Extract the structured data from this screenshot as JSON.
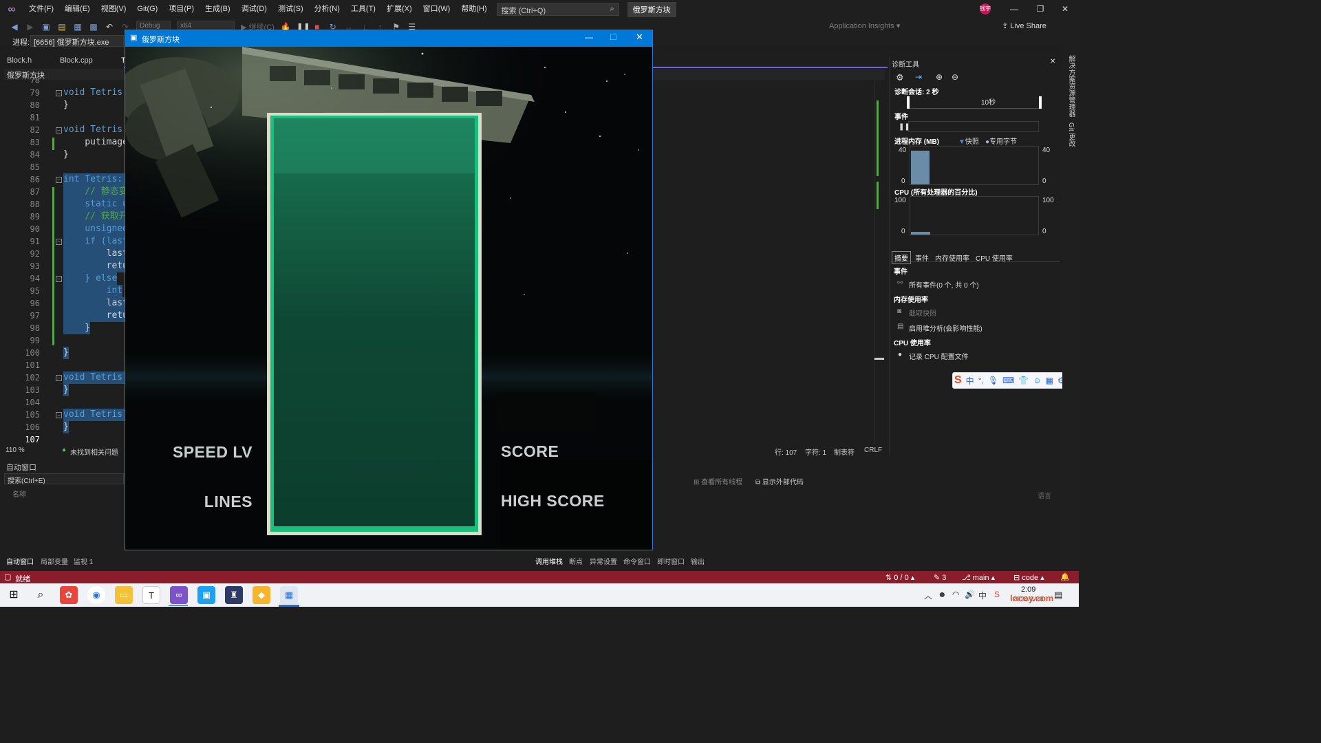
{
  "menubar": {
    "items": [
      "文件(F)",
      "编辑(E)",
      "视图(V)",
      "Git(G)",
      "项目(P)",
      "生成(B)",
      "调试(D)",
      "测试(S)",
      "分析(N)",
      "工具(T)",
      "扩展(X)",
      "窗口(W)",
      "帮助(H)"
    ],
    "search_placeholder": "搜索 (Ctrl+Q)",
    "solution_name": "俄罗斯方块",
    "user_initials": "钱宇"
  },
  "toolbar": {
    "config": "Debug",
    "platform": "x64",
    "continue_label": "继续(C)",
    "app_insights": "Application Insights",
    "live_share": "Live Share"
  },
  "process": {
    "label": "进程:",
    "value": "[6656] 俄罗斯方块.exe"
  },
  "tabs": {
    "items": [
      "Block.h",
      "Block.cpp",
      "T"
    ],
    "scope": "俄罗斯方块"
  },
  "editor": {
    "lines": [
      {
        "num": "78",
        "text": ""
      },
      {
        "num": "79",
        "text": "void Tetris::"
      },
      {
        "num": "80",
        "text": "}"
      },
      {
        "num": "81",
        "text": ""
      },
      {
        "num": "82",
        "text": "void Tetris::"
      },
      {
        "num": "83",
        "text": "    putimage"
      },
      {
        "num": "84",
        "text": "}"
      },
      {
        "num": "85",
        "text": ""
      },
      {
        "num": "86",
        "text": "int Tetris::g"
      },
      {
        "num": "87",
        "text": "    // 静态变"
      },
      {
        "num": "88",
        "text": "    static u"
      },
      {
        "num": "89",
        "text": "    // 获取开"
      },
      {
        "num": "90",
        "text": "    unsigned"
      },
      {
        "num": "91",
        "text": "    if (last"
      },
      {
        "num": "92",
        "text": "        last"
      },
      {
        "num": "93",
        "text": "        retu"
      },
      {
        "num": "94",
        "text": "    } else"
      },
      {
        "num": "95",
        "text": "        int"
      },
      {
        "num": "96",
        "text": "        last"
      },
      {
        "num": "97",
        "text": "        retu"
      },
      {
        "num": "98",
        "text": "    }"
      },
      {
        "num": "99",
        "text": ""
      },
      {
        "num": "100",
        "text": "}"
      },
      {
        "num": "101",
        "text": ""
      },
      {
        "num": "102",
        "text": "void Tetris::"
      },
      {
        "num": "103",
        "text": "}"
      },
      {
        "num": "104",
        "text": ""
      },
      {
        "num": "105",
        "text": "void Tetris::"
      },
      {
        "num": "106",
        "text": "}"
      },
      {
        "num": "107",
        "text": ""
      }
    ],
    "zoom": "110 %",
    "issues": "未找到相关问题",
    "line_label": "行: 107",
    "char_label": "字符: 1",
    "indent_label": "制表符",
    "eol_label": "CRLF"
  },
  "autos": {
    "title": "自动窗口",
    "search_placeholder": "搜索(Ctrl+E)",
    "col_name": "名称",
    "col_lang": "语言",
    "bottom_tabs": [
      "自动窗口",
      "局部变量",
      "监视 1"
    ]
  },
  "callstack": {
    "show_threads": "查看所有线程",
    "show_external": "显示外部代码",
    "bottom_tabs": [
      "调用堆栈",
      "断点",
      "异常设置",
      "命令窗口",
      "即时窗口",
      "输出"
    ]
  },
  "diagnostics": {
    "title": "诊断工具",
    "session": "诊断会话: 2 秒",
    "timeline_label": "10秒",
    "events_header": "事件",
    "memory_header": "进程内存 (MB)",
    "memory_legend_snapshot": "快照",
    "memory_legend_private": "专用字节",
    "memory_max_left": "40",
    "memory_min_left": "0",
    "memory_max_right": "40",
    "memory_min_right": "0",
    "cpu_header": "CPU (所有处理器的百分比)",
    "cpu_max_left": "100",
    "cpu_min_left": "0",
    "cpu_max_right": "100",
    "cpu_min_right": "0",
    "tabs": [
      "摘要",
      "事件",
      "内存使用率",
      "CPU 使用率"
    ],
    "summary_events": "事件",
    "all_events": "所有事件(0 个, 共 0 个)",
    "summary_memory": "内存使用率",
    "take_snapshot": "截取快照",
    "heap_analysis": "启用堆分析(会影响性能)",
    "summary_cpu": "CPU 使用率",
    "record_cpu": "记录 CPU 配置文件"
  },
  "right_strip": {
    "label1": "解决方案资源管理器",
    "label2": "Git 更改"
  },
  "statusbar": {
    "ready": "就绪",
    "sync": "0 / 0",
    "changes": "3",
    "branch": "main",
    "repo": "code"
  },
  "taskbar": {
    "time": "2:09",
    "date": "2024/3/20",
    "watermark": "locoy.com"
  },
  "game": {
    "title": "俄罗斯方块",
    "speed_label": "SPEED LV",
    "lines_label": "LINES",
    "score_label": "SCORE",
    "high_score_label": "HIGH SCORE"
  },
  "colors": {
    "accent": "#0078d7",
    "status_bar": "#8b1c2b",
    "selection": "#264f78",
    "well_green": "#19c07c"
  }
}
